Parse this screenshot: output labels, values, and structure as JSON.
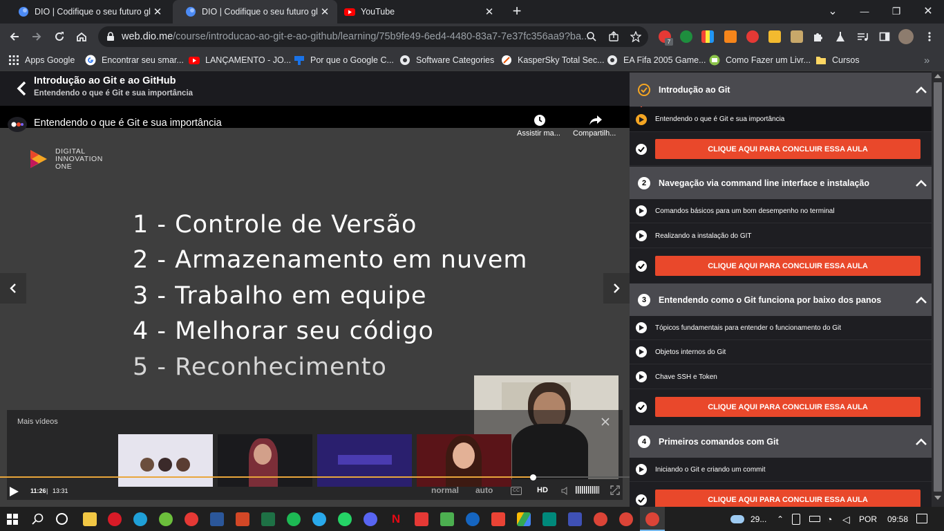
{
  "tabs": [
    {
      "title": "DIO | Codifique o seu futuro glob",
      "close": "✕",
      "active": false
    },
    {
      "title": "DIO | Codifique o seu futuro glob",
      "close": "✕",
      "active": true
    },
    {
      "title": "YouTube",
      "close": "✕",
      "active": false
    }
  ],
  "new_tab": "+",
  "window": {
    "minimize": "—",
    "restore": "❐",
    "close": "✕",
    "tab_search": "⌄"
  },
  "address": {
    "host": "web.dio.me",
    "path": "/course/introducao-ao-git-e-ao-github/learning/75b9fe49-6ed4-4480-83a7-7e37fc356aa9?ba..."
  },
  "extension_badge": "7",
  "bookmarks": [
    {
      "label": "Apps Google",
      "icon": "apps-grid-icon"
    },
    {
      "label": "Encontrar seu smar...",
      "icon": "google-icon"
    },
    {
      "label": "LANÇAMENTO - JO...",
      "icon": "youtube-icon"
    },
    {
      "label": "Por que o Google C...",
      "icon": "bookmark-blue-icon"
    },
    {
      "label": "Software Categories",
      "icon": "globe-icon"
    },
    {
      "label": "KasperSky Total Sec...",
      "icon": "kaspersky-icon"
    },
    {
      "label": "EA Fifa 2005 Game...",
      "icon": "globe-icon"
    },
    {
      "label": "Como Fazer um Livr...",
      "icon": "book-icon"
    },
    {
      "label": "Cursos",
      "icon": "folder-icon"
    }
  ],
  "bookmarks_more": "»",
  "course": {
    "title": "Introdução ao Git e ao GitHub",
    "subtitle": "Entendendo o que é Git e sua importância"
  },
  "video": {
    "title": "Entendendo o que é Git e sua importância",
    "watch_later": "Assistir ma...",
    "share": "Compartilh...",
    "brand": [
      "DIGITAL",
      "INNOVATION",
      "ONE"
    ],
    "slide_lines": [
      "1 - Controle de Versão",
      "2 - Armazenamento em nuvem",
      "3 - Trabalho em equipe",
      "4 - Melhorar seu código",
      "5 - Reconhecimento"
    ],
    "more_videos": "Mais vídeos",
    "current_time": "11:26",
    "duration": "13:31",
    "progress": 0.846,
    "speed": "normal",
    "quality_auto": "auto",
    "cc": "CC",
    "hd": "HD"
  },
  "sidebar": {
    "cta_label": "CLIQUE AQUI PARA CONCLUIR ESSA AULA",
    "sections": [
      {
        "num": "",
        "title": "Introdução ao Git",
        "lessons": [
          "Entendendo o que é Git e sua importância"
        ]
      },
      {
        "num": "2",
        "title": "Navegação via command line interface e instalação",
        "lessons": [
          "Comandos básicos para um bom desempenho no terminal",
          "Realizando a instalação do GIT"
        ]
      },
      {
        "num": "3",
        "title": "Entendendo como o Git funciona por baixo dos panos",
        "lessons": [
          "Tópicos fundamentais para entender o funcionamento do Git",
          "Objetos internos do Git",
          "Chave SSH e Token"
        ]
      },
      {
        "num": "4",
        "title": "Primeiros comandos com Git",
        "lessons": [
          "Iniciando o Git e criando um commit"
        ]
      }
    ]
  },
  "taskbar": {
    "weather": "29...",
    "language": "POR",
    "time": "09:58"
  },
  "colors": {
    "accent": "#e9482b",
    "chrome_dark": "#202124",
    "chrome_toolbar": "#35363a"
  }
}
